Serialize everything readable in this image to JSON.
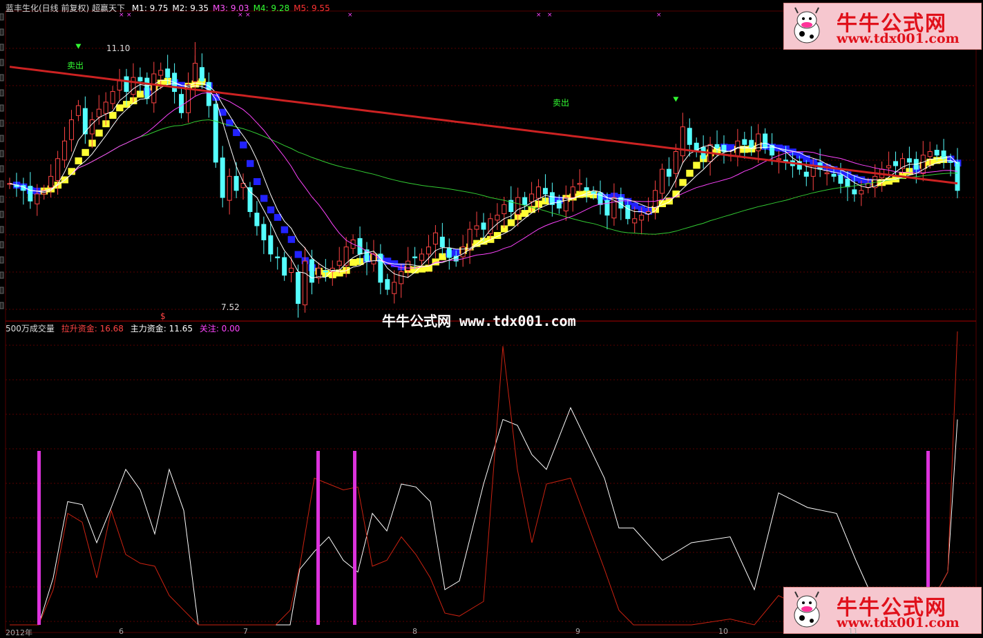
{
  "header": {
    "title": "蓝丰生化(日线 前复权) 超赢天下",
    "ma": [
      {
        "label": "M1: 9.75",
        "color": "#ffffff"
      },
      {
        "label": "M2: 9.35",
        "color": "#ffffff"
      },
      {
        "label": "M3: 9.03",
        "color": "#ff55ff"
      },
      {
        "label": "M4: 9.28",
        "color": "#33ff33"
      },
      {
        "label": "M5: 9.55",
        "color": "#ff3333"
      }
    ]
  },
  "indicator": {
    "name": "500万成交量",
    "lashen": "拉升资金: 16.68",
    "zhuli": "主力资金: 11.65",
    "guanzhu": "关注: 0.00"
  },
  "annotations": {
    "high": "11.10",
    "low": "7.52",
    "sell1": "卖出",
    "sell2": "卖出",
    "dollar": "$"
  },
  "watermark": {
    "brand": "牛牛公式网",
    "url": "www.tdx001.com",
    "center": "牛牛公式网 www.tdx001.com"
  },
  "x_labels": [
    "2012年",
    "6",
    "7",
    "8",
    "9",
    "10",
    "11"
  ],
  "colors": {
    "bg": "#000000",
    "up": "#ff4444",
    "down": "#55ffff",
    "ma_white": "#ffffff",
    "ma_magenta": "#ff44ff",
    "ma_green": "#33cc33",
    "ma_red": "#cc2222",
    "band_up": "#ffff33",
    "band_down": "#2222ff",
    "line_white": "#ffffff",
    "line_red": "#cc2211",
    "bar_magenta": "#dd33dd"
  },
  "chart_data": [
    {
      "type": "candlestick",
      "name": "蓝丰生化(日线 前复权)",
      "ylim": [
        7.2,
        11.5
      ],
      "n_days": 139,
      "closes": [
        9.1,
        9.05,
        9.0,
        8.85,
        8.95,
        9.0,
        9.2,
        9.45,
        9.7,
        10.0,
        10.2,
        9.8,
        10.0,
        10.15,
        10.25,
        10.4,
        10.55,
        10.4,
        10.6,
        10.55,
        10.3,
        10.65,
        10.7,
        10.6,
        10.4,
        10.1,
        10.5,
        10.8,
        10.55,
        10.2,
        9.4,
        8.9,
        9.2,
        9.0,
        9.1,
        8.7,
        8.5,
        8.3,
        8.1,
        8.05,
        7.8,
        7.9,
        7.4,
        8.0,
        7.7,
        7.9,
        7.85,
        7.9,
        8.0,
        8.2,
        8.3,
        8.1,
        8.0,
        8.1,
        7.7,
        7.6,
        7.7,
        7.85,
        8.0,
        8.05,
        8.1,
        8.2,
        8.4,
        8.2,
        8.05,
        8.0,
        8.2,
        8.45,
        8.5,
        8.45,
        8.6,
        8.65,
        8.8,
        8.7,
        8.9,
        8.8,
        8.95,
        9.05,
        8.95,
        8.8,
        8.75,
        8.9,
        9.05,
        9.1,
        9.0,
        8.95,
        8.8,
        8.65,
        8.9,
        8.75,
        8.6,
        8.6,
        8.65,
        8.7,
        9.0,
        9.3,
        9.2,
        9.55,
        9.9,
        9.65,
        9.55,
        9.45,
        9.65,
        9.6,
        9.55,
        9.5,
        9.7,
        9.65,
        9.6,
        9.8,
        9.6,
        9.5,
        9.45,
        9.4,
        9.35,
        9.3,
        9.2,
        9.35,
        9.3,
        9.25,
        9.2,
        9.1,
        9.05,
        8.95,
        9.0,
        9.1,
        9.2,
        9.3,
        9.35,
        9.35,
        9.45,
        9.4,
        9.3,
        9.5,
        9.55,
        9.5,
        9.45,
        9.4,
        9.0
      ],
      "high_label": 11.1,
      "low_label": 7.52
    },
    {
      "type": "line",
      "name": "500万成交量",
      "ylim": [
        0,
        100
      ],
      "series": [
        {
          "name": "拉升资金",
          "last": 16.68
        },
        {
          "name": "主力资金",
          "last": 11.65
        },
        {
          "name": "关注",
          "last": 0.0
        }
      ]
    }
  ]
}
